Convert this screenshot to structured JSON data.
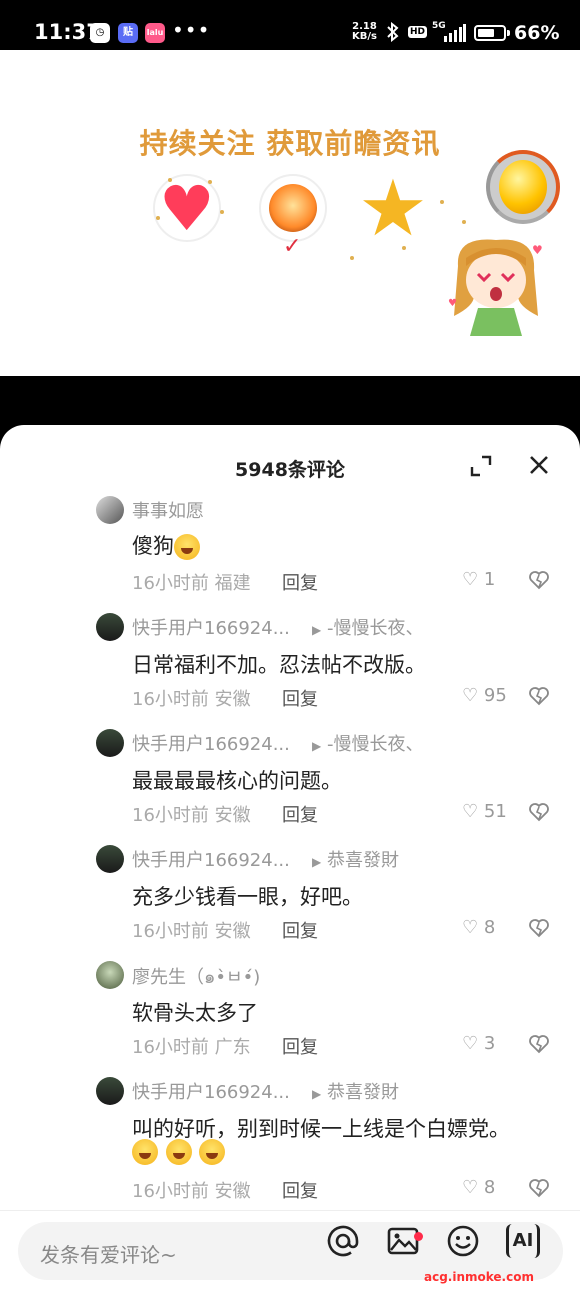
{
  "status_bar": {
    "time": "11:37",
    "app_icon_1": "◷",
    "app_icon_2": "贴",
    "app_icon_3": "lalu",
    "more": "•••",
    "net_speed_value": "2.18",
    "net_speed_unit": "KB/s",
    "hd": "HD",
    "network": "5G",
    "battery_level": 0.66,
    "battery": "66%"
  },
  "banner": {
    "title": "持续关注 获取前瞻资讯"
  },
  "sheet": {
    "title": "5948条评论"
  },
  "comments": [
    {
      "user": "事事如愿",
      "reply_to": "",
      "text": "傻狗",
      "emoji_count": 1,
      "time": "16小时前",
      "location": "福建",
      "reply_label": "回复",
      "likes": "1"
    },
    {
      "user": "快手用户166924...",
      "reply_to": "-慢慢长夜、",
      "text": "日常福利不加。忍法帖不改版。",
      "emoji_count": 0,
      "time": "16小时前",
      "location": "安徽",
      "reply_label": "回复",
      "likes": "95"
    },
    {
      "user": "快手用户166924...",
      "reply_to": "-慢慢长夜、",
      "text": "最最最最核心的问题。",
      "emoji_count": 0,
      "time": "16小时前",
      "location": "安徽",
      "reply_label": "回复",
      "likes": "51"
    },
    {
      "user": "快手用户166924...",
      "reply_to": "恭喜發財",
      "text": "充多少钱看一眼，好吧。",
      "emoji_count": 0,
      "time": "16小时前",
      "location": "安徽",
      "reply_label": "回复",
      "likes": "8"
    },
    {
      "user": "廖先生（๑•̀ㅂ•́)",
      "reply_to": "",
      "text": "软骨头太多了",
      "emoji_count": 0,
      "time": "16小时前",
      "location": "广东",
      "reply_label": "回复",
      "likes": "3"
    },
    {
      "user": "快手用户166924...",
      "reply_to": "恭喜發財",
      "text": "叫的好听，别到时候一上线是个白嫖党。",
      "emoji_count": 3,
      "time": "16小时前",
      "location": "安徽",
      "reply_label": "回复",
      "likes": "8"
    }
  ],
  "bottom_bar": {
    "placeholder": "发条有爱评论~",
    "icons": [
      "at-icon",
      "image-icon",
      "emoji-icon",
      "ai-icon"
    ],
    "ai_label": "AI"
  },
  "watermark": "acg.inmoke.com",
  "colors": {
    "accent_red": "#ff2b4a",
    "banner_gold": "#e09a3a"
  }
}
